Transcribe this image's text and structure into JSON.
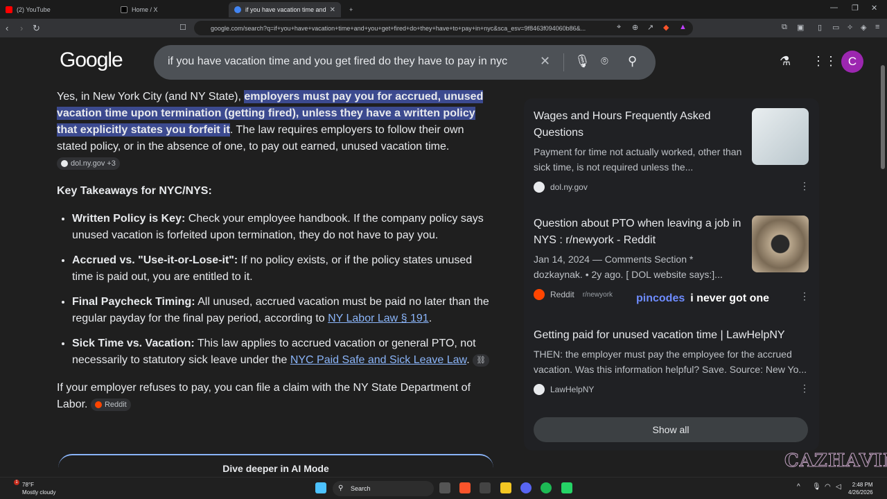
{
  "browser": {
    "tabs": [
      {
        "label": "(2) YouTube",
        "color": "#ff0000"
      },
      {
        "label": "Home / X",
        "color": "#000000"
      },
      {
        "label": "if you have vacation time and yo",
        "color": "#4285f4",
        "active": true
      }
    ],
    "new_tab": "+",
    "url": "google.com/search?q=if+you+have+vacation+time+and+you+get+fired+do+they+have+to+pay+in+nyc&sca_esv=9f8463f094060b86&..."
  },
  "google": {
    "logo": "Google",
    "query": "if you have vacation time and you get fired do they have to pay in nyc",
    "avatar_letter": "C"
  },
  "answer": {
    "intro_before": "Yes, in New York City (and NY State), ",
    "intro_highlight": "employers must pay you for accrued, unused vacation time upon termination (getting fired), unless they have a written policy that explicitly states you forfeit it",
    "intro_after": ". The law requires employers to follow their own stated policy, or in the absence of one, to pay out earned, unused vacation time.",
    "intro_chip": "dol.ny.gov +3",
    "takeaways_heading": "Key Takeaways for NYC/NYS:",
    "bullets": [
      {
        "bold": "Written Policy is Key:",
        "text": " Check your employee handbook. If the company policy says unused vacation is forfeited upon termination, they do not have to pay you."
      },
      {
        "bold": "Accrued vs. \"Use-it-or-Lose-it\":",
        "text": " If no policy exists, or if the policy states unused time is paid out, you are entitled to it."
      },
      {
        "bold": "Final Paycheck Timing:",
        "text": " All unused, accrued vacation must be paid no later than the regular payday for the final pay period, according to ",
        "link": "NY Labor Law § 191",
        "after": "."
      },
      {
        "bold": "Sick Time vs. Vacation:",
        "text": " This law applies to accrued vacation or general PTO, not necessarily to statutory sick leave under the ",
        "link": "NYC Paid Safe and Sick Leave Law",
        "after": "."
      }
    ],
    "closing": "If your employer refuses to pay, you can file a claim with the NY State Department of Labor.",
    "closing_chip": "Reddit",
    "ai_mode_button": "Dive deeper in AI Mode"
  },
  "sources": {
    "cards": [
      {
        "title": "Wages and Hours Frequently Asked Questions",
        "snippet": "Payment for time not actually worked, other than sick time, is not required unless the...",
        "source": "dol.ny.gov",
        "sub": ""
      },
      {
        "title": "Question about PTO when leaving a job in NYS : r/newyork - Reddit",
        "snippet": "Jan 14, 2024 — Comments Section * dozkaynak. • 2y ago. [ DOL website says:]...",
        "source": "Reddit",
        "sub": "r/newyork"
      },
      {
        "title": "Getting paid for unused vacation time | LawHelpNY",
        "snippet": "THEN: the employer must pay the employee for the accrued vacation. Was this information helpful? Save. Source: New Yo...",
        "source": "LawHelpNY",
        "sub": ""
      }
    ],
    "show_all": "Show all"
  },
  "overlay": {
    "part1": "pincodes",
    "part2": "i never got one"
  },
  "watermark": "CAZHAVIN",
  "taskbar": {
    "weather_temp": "78°F",
    "weather_desc": "Mostly cloudy",
    "weather_badge": "1",
    "search_label": "Search",
    "time": "2:48 PM",
    "date": "4/26/2026"
  }
}
